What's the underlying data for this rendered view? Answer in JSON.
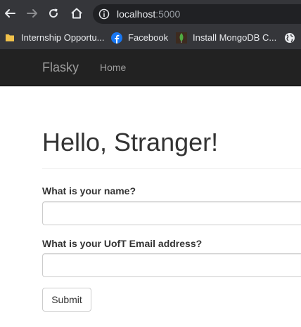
{
  "browser": {
    "url_host": "localhost",
    "url_port": ":5000",
    "bookmarks": [
      {
        "label": "Internship Opportu...",
        "icon": "folder-icon"
      },
      {
        "label": "Facebook",
        "icon": "facebook-icon"
      },
      {
        "label": "Install MongoDB C...",
        "icon": "mongodb-leaf-icon"
      }
    ],
    "toolbar_icons": [
      "back-arrow-icon",
      "forward-arrow-icon",
      "reload-icon",
      "home-icon",
      "info-icon",
      "globe-icon"
    ],
    "colors": {
      "toolbar_bg": "#35363a",
      "omnibox_bg": "#202124",
      "text": "#e8eaed",
      "muted_text": "#9aa0a6"
    }
  },
  "navbar": {
    "brand": "Flasky",
    "home_label": "Home",
    "colors": {
      "bg": "#222222",
      "text": "#9d9d9d"
    }
  },
  "page": {
    "title": "Hello, Stranger!"
  },
  "form": {
    "name_label": "What is your name?",
    "name_value": "",
    "email_label": "What is your UofT Email address?",
    "email_value": "",
    "submit_label": "Submit"
  }
}
